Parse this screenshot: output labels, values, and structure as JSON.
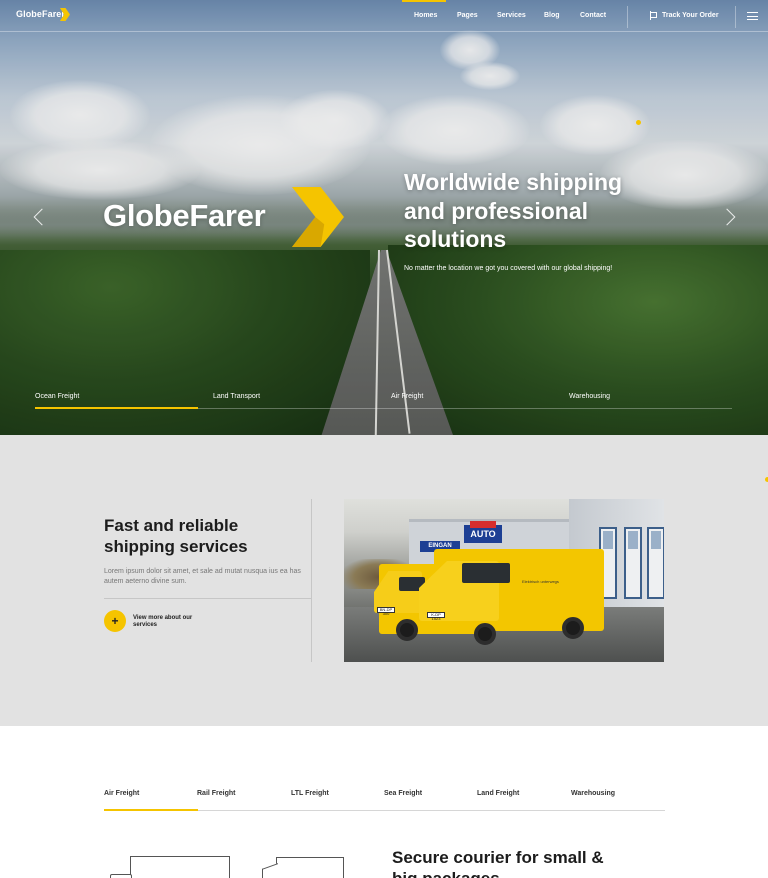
{
  "brand": {
    "name": "GlobeFarer",
    "accent_color": "#f5c400"
  },
  "nav": {
    "items": [
      {
        "label": "Homes",
        "active": true
      },
      {
        "label": "Pages",
        "active": false
      },
      {
        "label": "Services",
        "active": false
      },
      {
        "label": "Blog",
        "active": false
      },
      {
        "label": "Contact",
        "active": false
      }
    ],
    "track_label": "Track Your Order",
    "track_icon": "flag-icon",
    "menu_icon": "hamburger-menu-icon"
  },
  "hero": {
    "logo_text": "GlobeFarer",
    "heading": "Worldwide shipping and professional solutions",
    "subtitle": "No matter the location we got you covered with our global shipping!",
    "prev_icon": "chevron-left-icon",
    "next_icon": "chevron-right-icon",
    "tabs": [
      {
        "label": "Ocean Freight",
        "active": true
      },
      {
        "label": "Land Transport",
        "active": false
      },
      {
        "label": "Air Freight",
        "active": false
      },
      {
        "label": "Warehousing",
        "active": false
      }
    ]
  },
  "services": {
    "title": "Fast and reliable shipping services",
    "text": "Lorem ipsum dolor sit amet, et sale ad mutat nusqua ius ea has autem aeterno divine sum.",
    "button_icon": "+",
    "button_label": "View more about our services",
    "photo": {
      "sign_text": "AUTO",
      "sign2_text": "EINGAN",
      "plate1": "BN-DP 300",
      "plate2": "K-DP 1523",
      "van_text": "Elektrisch unterwegs"
    },
    "background_color": "#e2e2e2"
  },
  "freight_tabs": [
    {
      "label": "Air Freight",
      "active": true
    },
    {
      "label": "Rail Freight",
      "active": false
    },
    {
      "label": "LTL Freight",
      "active": false
    },
    {
      "label": "Sea Freight",
      "active": false
    },
    {
      "label": "Land Freight",
      "active": false
    },
    {
      "label": "Warehousing",
      "active": false
    }
  ],
  "bottom": {
    "title": "Secure courier for small & big packages"
  }
}
